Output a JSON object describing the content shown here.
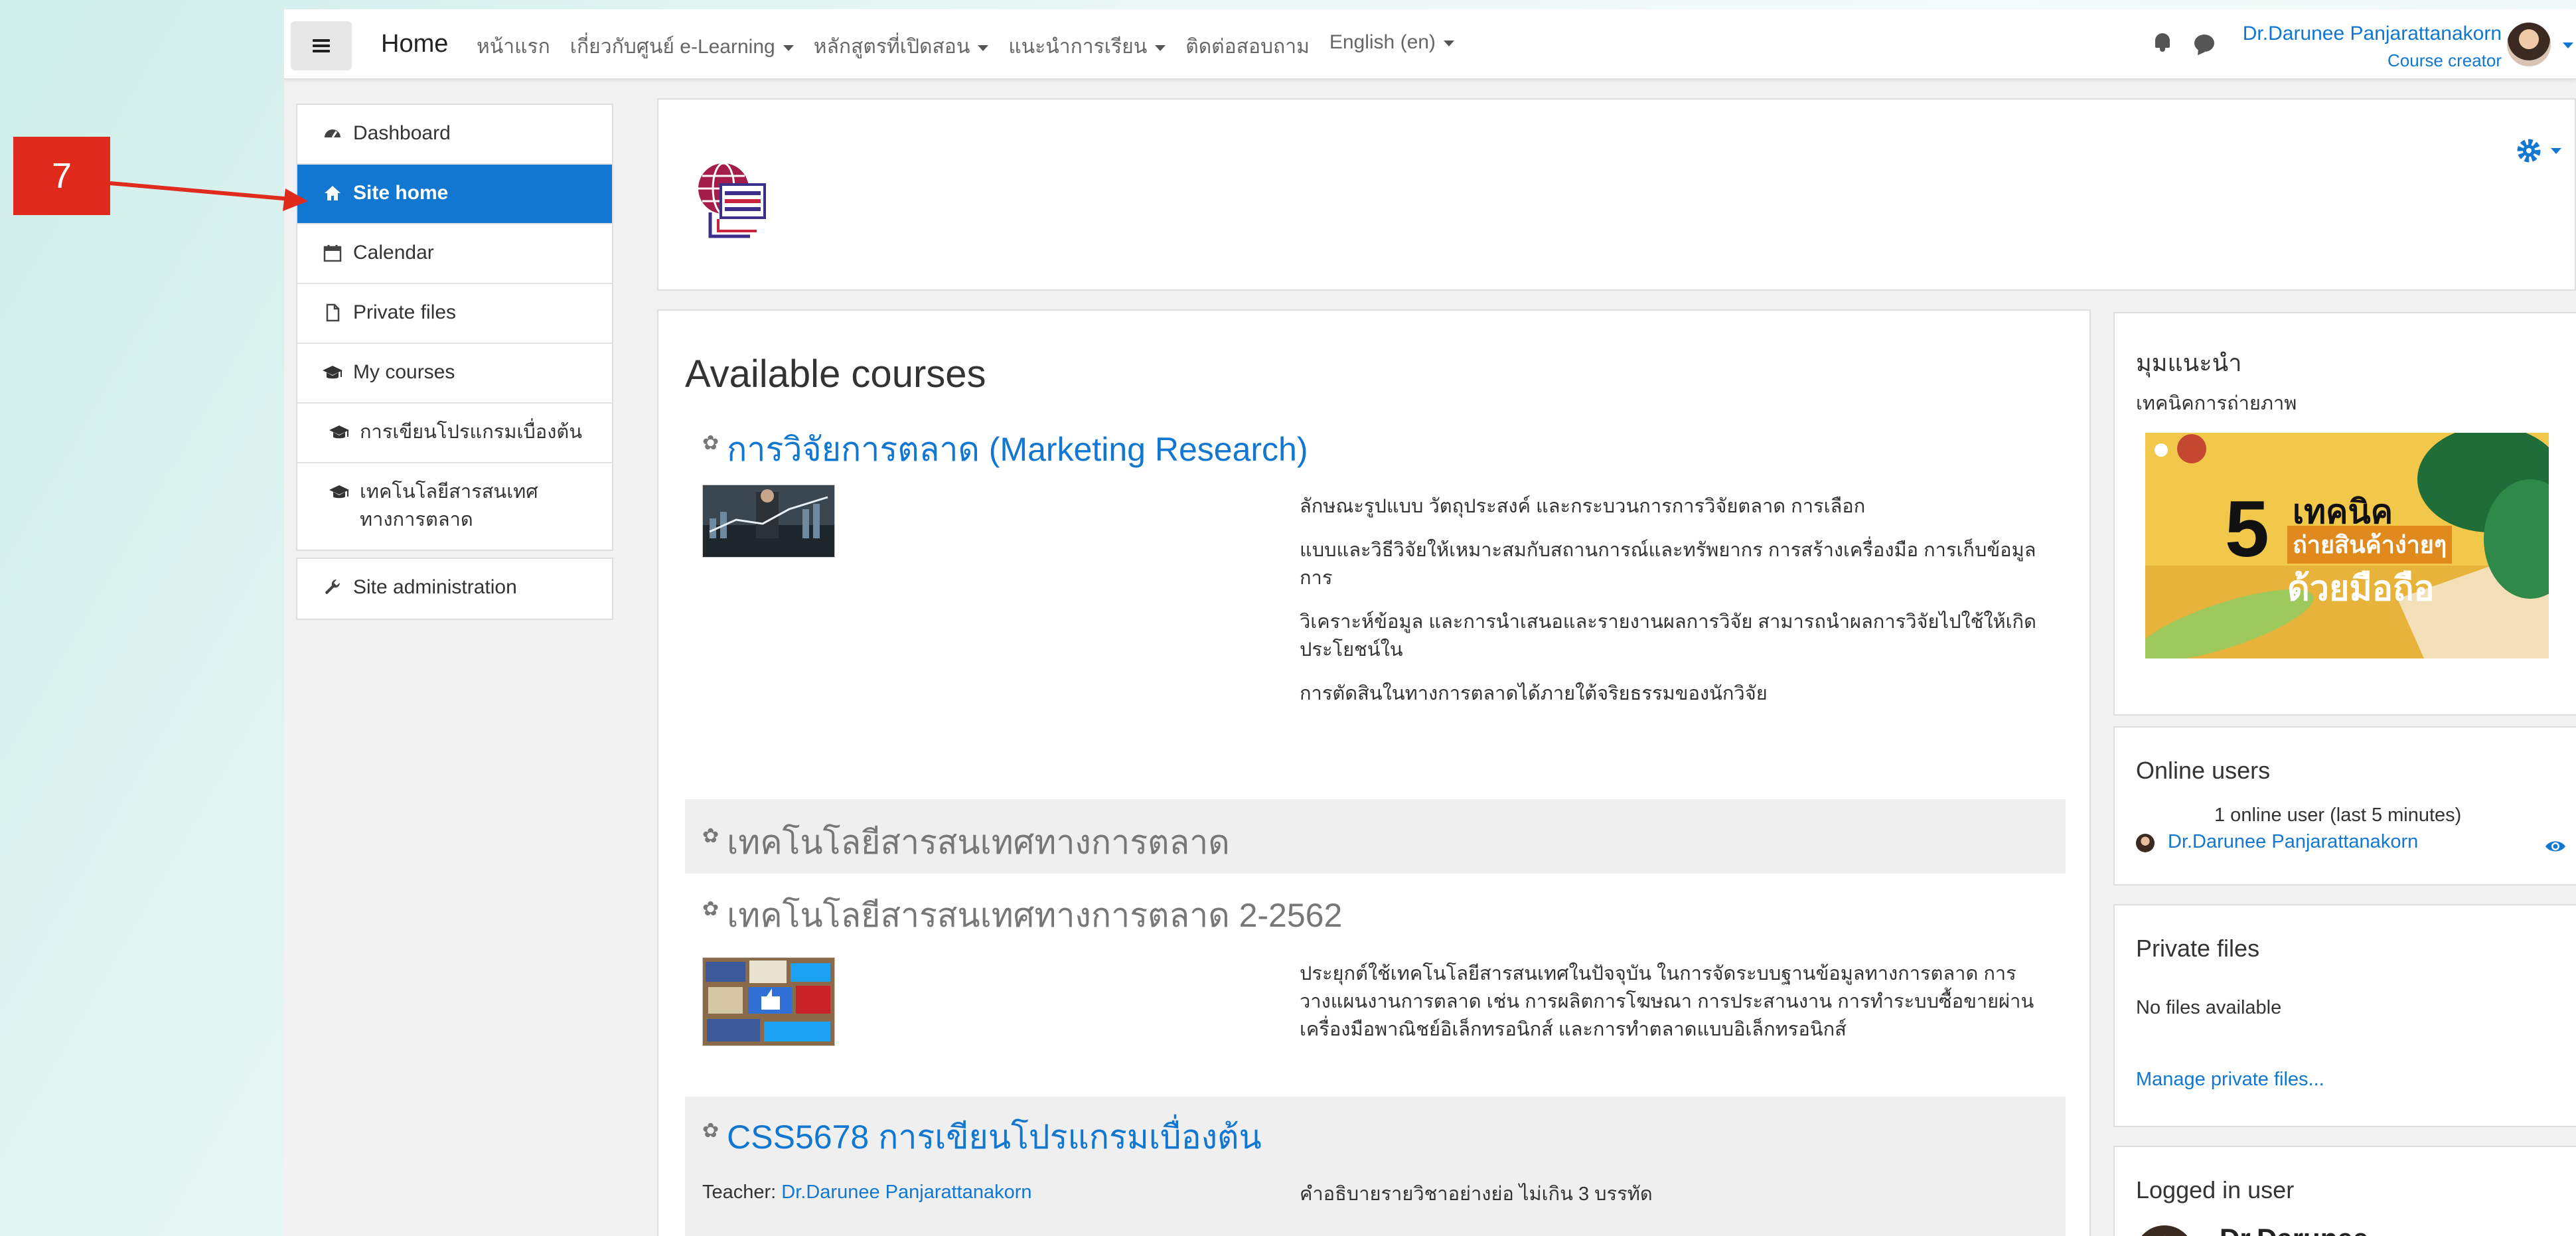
{
  "annotation": {
    "label": "7"
  },
  "navbar": {
    "brand": "Home",
    "menu": [
      {
        "label": "หน้าแรก",
        "dropdown": false
      },
      {
        "label": "เกี่ยวกับศูนย์ e-Learning",
        "dropdown": true
      },
      {
        "label": "หลักสูตรที่เปิดสอน",
        "dropdown": true
      },
      {
        "label": "แนะนำการเรียน",
        "dropdown": true
      },
      {
        "label": "ติดต่อสอบถาม",
        "dropdown": false
      },
      {
        "label": "English (en)",
        "dropdown": true
      }
    ],
    "user_name": "Dr.Darunee Panjarattanakorn",
    "user_role": "Course creator",
    "icons": [
      "bell-icon",
      "chat-icon",
      "hamburger-icon"
    ]
  },
  "sidebar": {
    "items": [
      {
        "label": "Dashboard",
        "icon": "tachometer-icon"
      },
      {
        "label": "Site home",
        "icon": "home-icon",
        "active": true
      },
      {
        "label": "Calendar",
        "icon": "calendar-icon"
      },
      {
        "label": "Private files",
        "icon": "file-icon"
      },
      {
        "label": "My courses",
        "icon": "graduation-cap-icon"
      },
      {
        "label": "การเขียนโปรแกรมเบื่องต้น",
        "icon": "graduation-cap-icon"
      },
      {
        "label": "เทคโนโลยีสารสนเทศทางการตลาด",
        "icon": "graduation-cap-icon"
      }
    ],
    "admin": {
      "label": "Site administration",
      "icon": "wrench-icon"
    }
  },
  "main": {
    "title": "Available courses",
    "courses": [
      {
        "title": "การวิจัยการตลาด (Marketing Research)",
        "summary": [
          "ลักษณะรูปแบบ วัตถุประสงค์ และกระบวนการการวิจัยตลาด การเลือก",
          "แบบและวิธีวิจัยให้เหมาะสมกับสถานการณ์และทรัพยากร การสร้างเครื่องมือ การเก็บข้อมูล การ",
          "วิเคราะห์ข้อมูล และการนำเสนอและรายงานผลการวิจัย สามารถนำผลการวิจัยไปใช้ให้เกิดประโยชน์ใน",
          "การตัดสินในทางการตลาดได้ภายใต้จริยธรรมของนักวิจัย"
        ]
      },
      {
        "title": "เทคโนโลยีสารสนเทศทางการตลาด"
      },
      {
        "title": "เทคโนโลยีสารสนเทศทางการตลาด 2-2562",
        "summary": [
          "ประยุกต์ใช้เทคโนโลยีสารสนเทศในปัจจุบัน ในการจัดระบบฐานข้อมูลทางการตลาด การวางแผนงานการตลาด เช่น การผลิตการโฆษณา การประสานงาน การทำระบบซื้อขายผ่านเครื่องมือพาณิชย์อิเล็กทรอนิกส์ และการทำตลาดแบบอิเล็กทรอนิกส์"
        ]
      },
      {
        "title": "CSS5678 การเขียนโปรแกรมเบื่องต้น",
        "teacher_label": "Teacher:",
        "teacher_name": "Dr.Darunee Panjarattanakorn",
        "summary": [
          "คำอธิบายรายวิชาอย่างย่อ  ไม่เกิน 3 บรรทัด"
        ]
      }
    ]
  },
  "blocks": {
    "featured": {
      "title": "มุมแนะนำ",
      "subtitle": "เทคนิคการถ่ายภาพ",
      "banner": {
        "number": "5",
        "line1": "เทคนิค",
        "line2": "ถ่ายสินค้าง่ายๆ",
        "line3": "ด้วยมือถือ"
      }
    },
    "online_users": {
      "title": "Online users",
      "count_text": "1 online user (last 5 minutes)",
      "user": "Dr.Darunee Panjarattanakorn"
    },
    "private_files": {
      "title": "Private files",
      "empty_text": "No files available",
      "manage_link": "Manage private files..."
    },
    "logged_in_user": {
      "title": "Logged in user",
      "name": "Dr.Darunee"
    }
  },
  "colors": {
    "accent": "#1177d1",
    "annotation": "#e02a1c"
  }
}
